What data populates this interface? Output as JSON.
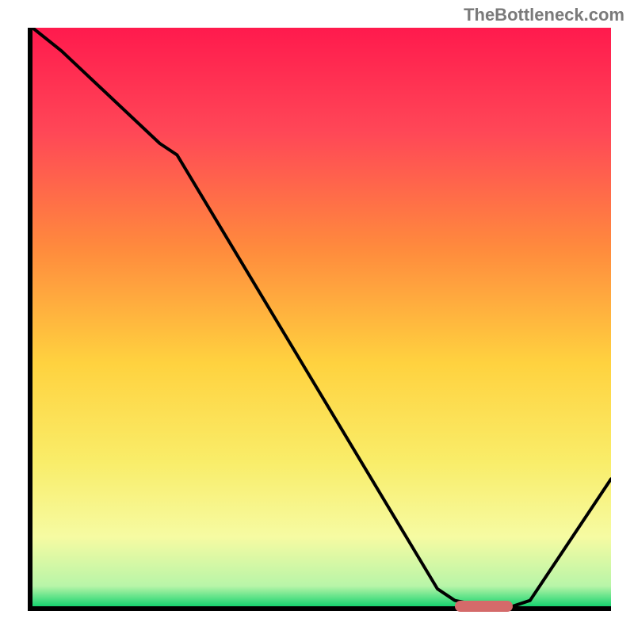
{
  "watermark": {
    "text": "TheBottleneck.com"
  },
  "colors": {
    "axis": "#000000",
    "curve": "#000000",
    "marker": "#d46a6a",
    "gradient_stops": [
      {
        "offset": 0.0,
        "color": "#ff1a4d"
      },
      {
        "offset": 0.18,
        "color": "#ff4757"
      },
      {
        "offset": 0.38,
        "color": "#ff8a3d"
      },
      {
        "offset": 0.58,
        "color": "#ffd23f"
      },
      {
        "offset": 0.75,
        "color": "#f9ed69"
      },
      {
        "offset": 0.88,
        "color": "#f6fba2"
      },
      {
        "offset": 0.965,
        "color": "#b8f5a8"
      },
      {
        "offset": 1.0,
        "color": "#17d36f"
      }
    ]
  },
  "chart_data": {
    "type": "line",
    "title": "",
    "xlabel": "",
    "ylabel": "",
    "xlim": [
      0,
      100
    ],
    "ylim": [
      0,
      100
    ],
    "x": [
      0,
      5,
      22,
      25,
      70,
      73,
      78,
      83,
      86,
      100
    ],
    "values": [
      100,
      96,
      80,
      78,
      3,
      1,
      0,
      0,
      1,
      22
    ],
    "marker": {
      "x_start": 73,
      "x_end": 83,
      "y": 0
    },
    "note": "Values are read off the figure as percentages of the plot area; the curve drops steeply, flattens at the bottom near x≈73–83 where a red rounded marker sits on the floor, then rises toward the right edge."
  }
}
